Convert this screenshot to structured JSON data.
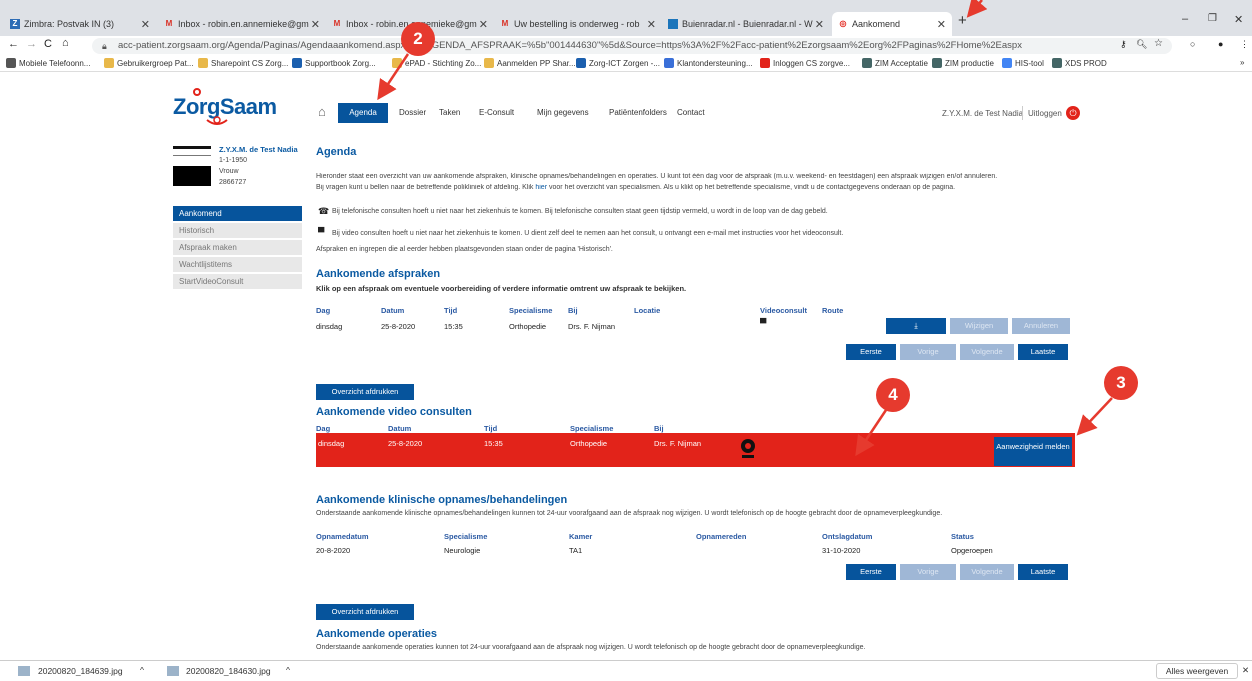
{
  "browser": {
    "tabs": [
      {
        "label": "Zimbra: Postvak IN (3)"
      },
      {
        "label": "Inbox - robin.en.annemieke@gm"
      },
      {
        "label": "Inbox - robin.en.annemieke@gm"
      },
      {
        "label": "Uw bestelling is onderweg - rob"
      },
      {
        "label": "Buienradar.nl - Buienradar.nl - W"
      },
      {
        "label": "Aankomend"
      }
    ],
    "url": "acc-patient.zorgsaam.org/Agenda/Paginas/Agendaaankomend.aspx?ID_AGENDA_AFSPRAAK=%5b\"001444630\"%5d&Source=https%3A%2F%2Facc-patient%2Ezorgsaam%2Eorg%2FPaginas%2FHome%2Easpx",
    "bookmarks": [
      "Mobiele Telefoonn...",
      "Gebruikergroep Pat...",
      "Sharepoint CS Zorg...",
      "Supportbook Zorg...",
      "ePAD - Stichting Zo...",
      "Aanmelden PP Shar...",
      "Zorg-ICT Zorgen -...",
      "Klantondersteuning...",
      "Inloggen CS zorgve...",
      "ZIM Acceptatie",
      "ZIM productie",
      "HIS-tool",
      "XDS PROD"
    ]
  },
  "site": {
    "logo": "ZorgSaam",
    "nav": [
      "Agenda",
      "Dossier",
      "Taken",
      "E-Consult",
      "Mijn gegevens",
      "Patiëntenfolders",
      "Contact"
    ],
    "user": "Z.Y.X.M. de Test Nadia",
    "logout": "Uitloggen"
  },
  "patient": {
    "name": "Z.Y.X.M. de Test Nadia",
    "dob": "1-1-1950",
    "gender": "Vrouw",
    "number": "2866727"
  },
  "sidebar": [
    "Aankomend",
    "Historisch",
    "Afspraak maken",
    "Wachtlijstitems",
    "StartVideoConsult"
  ],
  "page": {
    "title": "Agenda",
    "intro1": "Hieronder staat een overzicht van uw aankomende afspraken, klinische opnames/behandelingen en operaties. U kunt tot één dag voor de afspraak (m.u.v. weekend- en feestdagen) een afspraak wijzigen en/of annuleren.",
    "intro2a": "Bij vragen kunt u bellen naar de betreffende polikliniek of afdeling. Klik ",
    "intro2link": "hier",
    "intro2b": " voor het overzicht van specialismen. Als u klikt op het betreffende specialisme, vindt u de contactgegevens onderaan op de pagina.",
    "phone_note": "Bij telefonische consulten hoeft u niet naar het ziekenhuis te komen. Bij telefonische consulten staat geen tijdstip vermeld, u wordt in de loop van de dag gebeld.",
    "video_note": "Bij video consulten hoeft u niet naar het ziekenhuis te komen. U dient zelf deel te nemen aan het consult, u ontvangt een e-mail met instructies voor het videoconsult.",
    "history_note": "Afspraken en ingrepen die al eerder hebben plaatsgevonden staan onder de pagina 'Historisch'."
  },
  "appointments": {
    "title": "Aankomende afspraken",
    "subtitle": "Klik op een afspraak om eventuele voorbereiding of verdere informatie omtrent uw afspraak te bekijken.",
    "headers": [
      "Dag",
      "Datum",
      "Tijd",
      "Specialisme",
      "Bij",
      "Locatie",
      "Videoconsult",
      "Route"
    ],
    "row": {
      "day": "dinsdag",
      "date": "25-8-2020",
      "time": "15:35",
      "specialism": "Orthopedie",
      "by": "Drs. F. Nijman"
    },
    "btn_download": "⤓",
    "btn_change": "Wijzigen",
    "btn_cancel": "Annuleren"
  },
  "pager": [
    "Eerste",
    "Vorige",
    "Volgende",
    "Laatste"
  ],
  "print_button": "Overzicht afdrukken",
  "video": {
    "title": "Aankomende video consulten",
    "headers": [
      "Dag",
      "Datum",
      "Tijd",
      "Specialisme",
      "Bij"
    ],
    "row": {
      "day": "dinsdag",
      "date": "25-8-2020",
      "time": "15:35",
      "specialism": "Orthopedie",
      "by": "Drs. F. Nijman"
    },
    "button": "Aanwezigheid melden"
  },
  "clinical": {
    "title": "Aankomende klinische opnames/behandelingen",
    "subtitle": "Onderstaande aankomende klinische opnames/behandelingen kunnen tot 24-uur voorafgaand aan de afspraak nog wijzigen. U wordt telefonisch op de hoogte gebracht door de opnameverpleegkundige.",
    "headers": [
      "Opnamedatum",
      "Specialisme",
      "Kamer",
      "Opnamereden",
      "Ontslagdatum",
      "Status"
    ],
    "row": {
      "admission": "20-8-2020",
      "specialism": "Neurologie",
      "room": "TA1",
      "reason": "",
      "discharge": "31-10-2020",
      "status": "Opgeroepen"
    }
  },
  "operations": {
    "title": "Aankomende operaties",
    "subtitle": "Onderstaande aankomende operaties kunnen tot 24-uur voorafgaand aan de afspraak nog wijzigen. U wordt telefonisch op de hoogte gebracht door de opnameverpleegkundige."
  },
  "callouts": [
    "2",
    "3",
    "4"
  ],
  "downloads": {
    "files": [
      "20200820_184639.jpg",
      "20200820_184630.jpg"
    ],
    "show_all": "Alles weergeven"
  },
  "colors": {
    "primary": "#06549c",
    "highlight_row": "#e2231a",
    "callout": "#e63a2e"
  }
}
